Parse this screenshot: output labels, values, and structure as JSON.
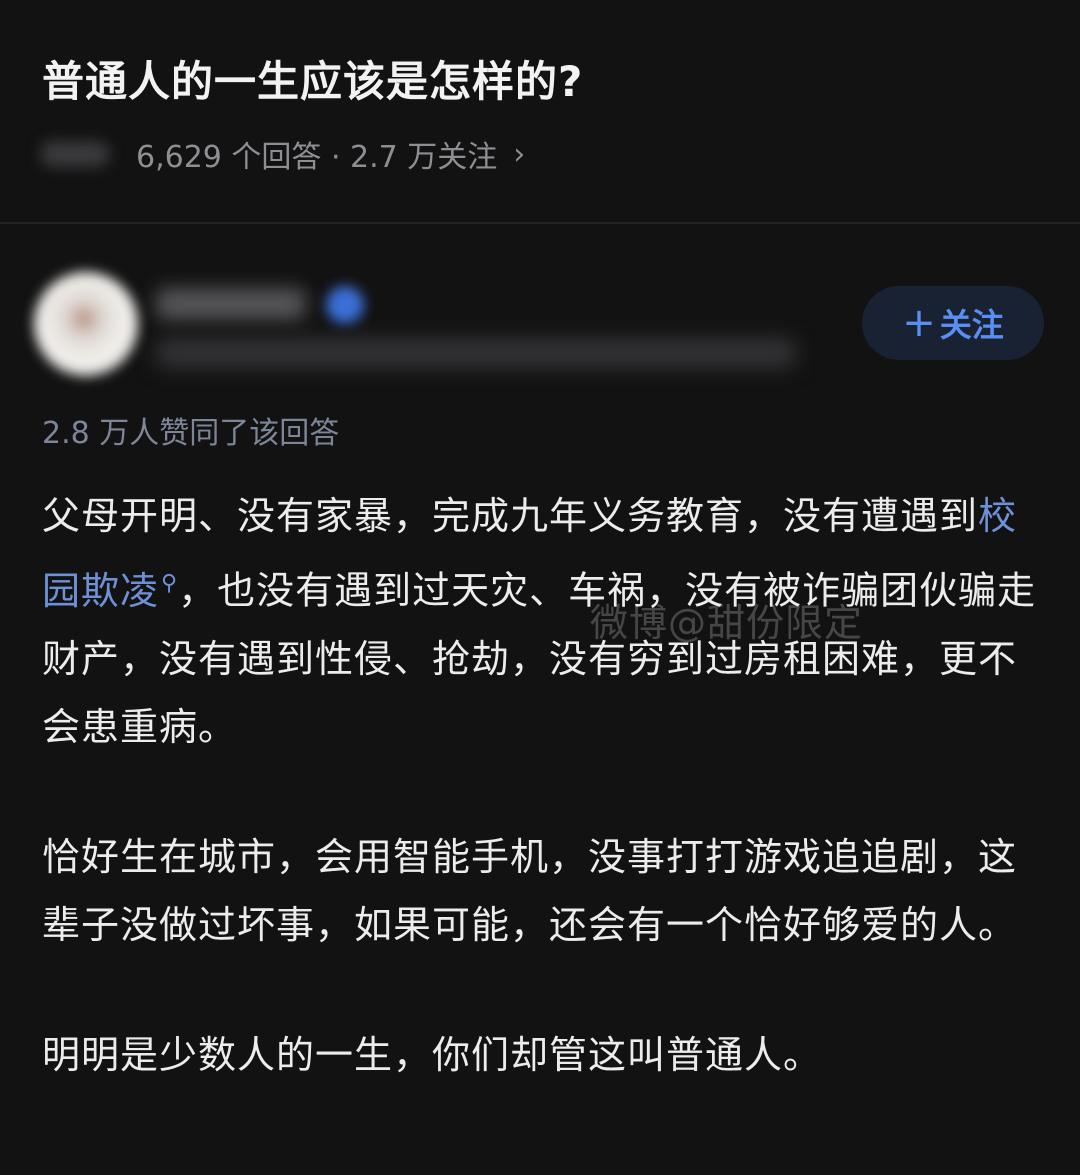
{
  "question": {
    "title": "普通人的一生应该是怎样的?",
    "meta": "6,629 个回答 · 2.7 万关注",
    "chevron": "›"
  },
  "author": {
    "follow_plus": "+",
    "follow_label": "关注"
  },
  "answer": {
    "vote_text": "2.8 万人赞同了该回答",
    "p1_before": "父母开明、没有家暴，完成九年义务教育，没有遭遇到",
    "p1_link": "校园欺凌",
    "p1_link_icon": "⚲",
    "p1_after": "，也没有遇到过天灾、车祸，没有被诈骗团伙骗走财产，没有遇到性侵、抢劫，没有穷到过房租困难，更不会患重病。",
    "p2": "恰好生在城市，会用智能手机，没事打打游戏追追剧，这辈子没做过坏事，如果可能，还会有一个恰好够爱的人。",
    "p3": "明明是少数人的一生，你们却管这叫普通人。"
  },
  "watermark": "微博@甜份限定",
  "colors": {
    "background": "#121212",
    "link": "#6e90d6",
    "follow_button_bg": "#192233",
    "follow_button_text": "#5a8ef2",
    "muted": "#8e8e93"
  }
}
